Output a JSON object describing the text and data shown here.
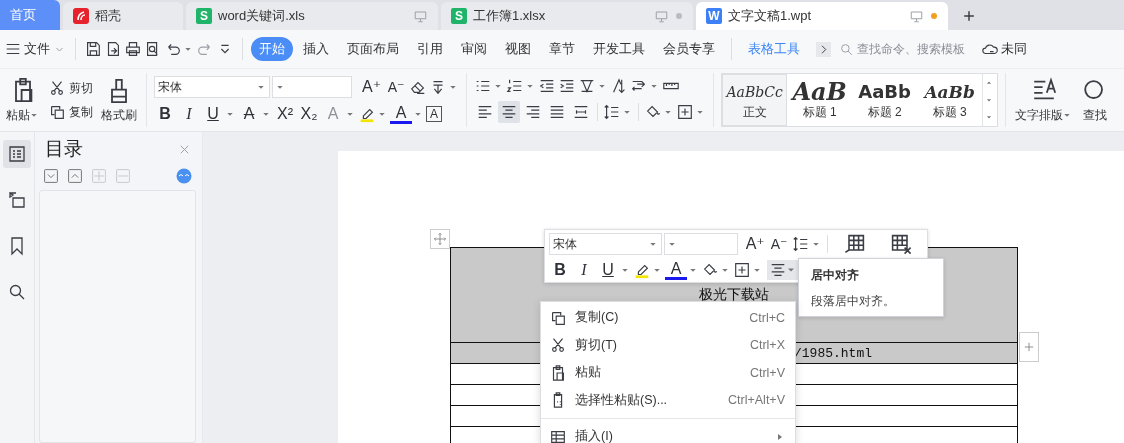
{
  "tabs": [
    {
      "label": "首页",
      "kind": "home",
      "selected": false
    },
    {
      "label": "稻壳",
      "kind": "docer",
      "selected": false
    },
    {
      "label": "word关键词.xls",
      "kind": "sheet",
      "badge": "S",
      "dot": false,
      "selected": false
    },
    {
      "label": "工作簿1.xlsx",
      "kind": "sheet",
      "badge": "S",
      "dot": true,
      "selected": false
    },
    {
      "label": "文字文稿1.wpt",
      "kind": "writer",
      "badge": "W",
      "dot": true,
      "selected": true
    }
  ],
  "menu": {
    "file": "文件",
    "tabs": [
      {
        "label": "开始",
        "kind": "main",
        "selected": true
      },
      {
        "label": "插入",
        "kind": "main",
        "selected": false
      },
      {
        "label": "页面布局",
        "kind": "main",
        "selected": false
      },
      {
        "label": "引用",
        "kind": "main",
        "selected": false
      },
      {
        "label": "审阅",
        "kind": "main",
        "selected": false
      },
      {
        "label": "视图",
        "kind": "main",
        "selected": false
      },
      {
        "label": "章节",
        "kind": "main",
        "selected": false
      },
      {
        "label": "开发工具",
        "kind": "main",
        "selected": false
      },
      {
        "label": "会员专享",
        "kind": "main",
        "selected": false
      },
      {
        "label": "表格工具",
        "kind": "contextual",
        "selected": false
      }
    ],
    "search": {
      "placeholder": "查找命令、搜索模板"
    },
    "sync": "未同"
  },
  "ribbon": {
    "clipboard": {
      "paste": "粘贴",
      "cut": "剪切",
      "copy": "复制",
      "format_painter": "格式刷"
    },
    "font": {
      "name": "宋体",
      "row1": [
        {
          "glyph": "A⁺",
          "kind": "grow"
        },
        {
          "glyph": "A⁻",
          "kind": "shrink"
        }
      ],
      "row2": [
        {
          "glyph": "B",
          "kind": "bold"
        },
        {
          "glyph": "I",
          "kind": "italic"
        },
        {
          "glyph": "U",
          "kind": "underline"
        },
        {
          "glyph": "A",
          "kind": "strike"
        },
        {
          "glyph": "X²",
          "kind": "superscript"
        },
        {
          "glyph": "X₂",
          "kind": "subscript"
        },
        {
          "glyph": "A",
          "kind": "effect"
        },
        {
          "kind": "highlight"
        },
        {
          "glyph": "A",
          "kind": "color"
        },
        {
          "glyph": "A",
          "kind": "boxed"
        }
      ]
    },
    "alignment": [
      {
        "kind": "left",
        "selected": false
      },
      {
        "kind": "center",
        "selected": true
      },
      {
        "kind": "right",
        "selected": false
      },
      {
        "kind": "justify",
        "selected": false
      },
      {
        "kind": "distributed",
        "selected": false
      }
    ],
    "styles": [
      {
        "preview": "AaBbCc",
        "label": "正文",
        "kind": "body",
        "selected": true
      },
      {
        "preview": "AaB",
        "label": "标题 1",
        "kind": "h1",
        "selected": false
      },
      {
        "preview": "AaBb",
        "label": "标题 2",
        "kind": "h2",
        "selected": false
      },
      {
        "preview": "AaBb",
        "label": "标题 3",
        "kind": "h3",
        "selected": false
      }
    ],
    "text_layout": "文字排版",
    "find": "查找"
  },
  "side_tools": [
    {
      "kind": "toc",
      "selected": true
    },
    {
      "kind": "nav",
      "selected": false
    },
    {
      "kind": "bookmark",
      "selected": false
    },
    {
      "kind": "search",
      "selected": false
    }
  ],
  "toc_panel": {
    "title": "目录",
    "buttons": [
      {
        "kind": "down",
        "disabled": false
      },
      {
        "kind": "up",
        "disabled": false
      },
      {
        "kind": "plus",
        "disabled": true
      },
      {
        "kind": "minus",
        "disabled": true
      }
    ]
  },
  "table": {
    "rows": [
      {
        "kind": "title",
        "text": "极光下载站",
        "shaded": true
      },
      {
        "kind": "code",
        "text": "/1985.html",
        "shaded": true
      },
      {
        "kind": "blank",
        "shaded": false
      },
      {
        "kind": "blank",
        "shaded": false
      },
      {
        "kind": "blank",
        "shaded": false
      },
      {
        "kind": "blank",
        "shaded": false
      }
    ]
  },
  "float_toolbar": {
    "font": "宋体",
    "row1": [
      {
        "glyph": "A⁺",
        "kind": "grow"
      },
      {
        "glyph": "A⁻",
        "kind": "shrink"
      }
    ],
    "row2": [
      {
        "glyph": "B",
        "kind": "bold"
      },
      {
        "glyph": "I",
        "kind": "italic"
      },
      {
        "glyph": "U",
        "kind": "underline"
      },
      {
        "kind": "highlight"
      },
      {
        "glyph": "A",
        "kind": "color"
      }
    ],
    "align_highlighted": true
  },
  "tooltip": {
    "title": "居中对齐",
    "text": "段落居中对齐。"
  },
  "context_menu": [
    {
      "kind": "copy",
      "label": "复制(C)",
      "shortcut": "Ctrl+C"
    },
    {
      "kind": "cut",
      "label": "剪切(T)",
      "shortcut": "Ctrl+X"
    },
    {
      "kind": "paste",
      "label": "粘贴",
      "shortcut": "Ctrl+V"
    },
    {
      "kind": "special",
      "label": "选择性粘贴(S)...",
      "shortcut": "Ctrl+Alt+V"
    },
    {
      "kind": "insert",
      "label": "插入(I)",
      "submenu": true
    }
  ]
}
